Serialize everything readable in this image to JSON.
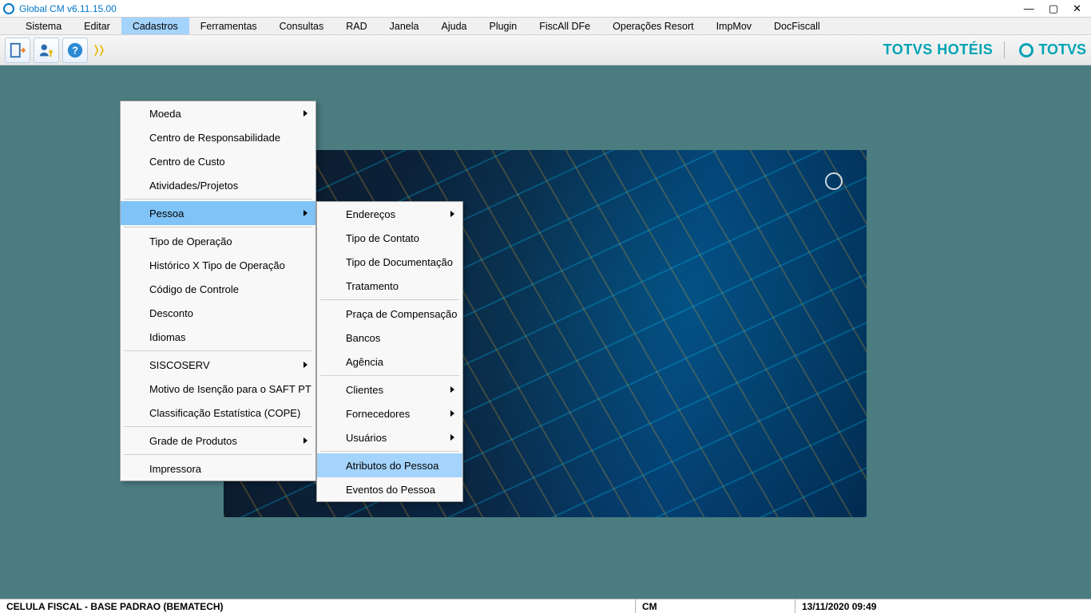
{
  "window": {
    "title": "Global CM v6.11.15.00"
  },
  "menubar": {
    "items": [
      {
        "label": "Sistema"
      },
      {
        "label": "Editar"
      },
      {
        "label": "Cadastros",
        "active": true
      },
      {
        "label": "Ferramentas"
      },
      {
        "label": "Consultas"
      },
      {
        "label": "RAD"
      },
      {
        "label": "Janela"
      },
      {
        "label": "Ajuda"
      },
      {
        "label": "Plugin"
      },
      {
        "label": "FiscAll DFe"
      },
      {
        "label": "Operações Resort"
      },
      {
        "label": "ImpMov"
      },
      {
        "label": "DocFiscall"
      }
    ]
  },
  "brand": {
    "text1": "TOTVS HOTÉIS",
    "text2": "TOTVS"
  },
  "dropdown_main": {
    "items": [
      {
        "label": "Moeda",
        "submenu": true
      },
      {
        "label": "Centro de Responsabilidade"
      },
      {
        "label": "Centro de Custo"
      },
      {
        "label": "Atividades/Projetos"
      },
      {
        "sep": true
      },
      {
        "label": "Pessoa",
        "submenu": true,
        "hover": true
      },
      {
        "sep": true
      },
      {
        "label": "Tipo de Operação"
      },
      {
        "label": "Histórico  X Tipo de Operação"
      },
      {
        "label": "Código de Controle"
      },
      {
        "label": "Desconto"
      },
      {
        "label": "Idiomas"
      },
      {
        "sep": true
      },
      {
        "label": "SISCOSERV",
        "submenu": true
      },
      {
        "label": "Motivo de Isenção para o SAFT PT"
      },
      {
        "label": "Classificação Estatística (COPE)"
      },
      {
        "sep": true
      },
      {
        "label": "Grade de Produtos",
        "submenu": true
      },
      {
        "sep": true
      },
      {
        "label": "Impressora"
      }
    ]
  },
  "dropdown_sub": {
    "items": [
      {
        "label": "Endereços",
        "submenu": true
      },
      {
        "label": "Tipo de Contato"
      },
      {
        "label": "Tipo de Documentação"
      },
      {
        "label": "Tratamento"
      },
      {
        "sep": true
      },
      {
        "label": "Praça de Compensação"
      },
      {
        "label": "Bancos"
      },
      {
        "label": "Agência"
      },
      {
        "sep": true
      },
      {
        "label": "Clientes",
        "submenu": true
      },
      {
        "label": "Fornecedores",
        "submenu": true
      },
      {
        "label": "Usuários",
        "submenu": true
      },
      {
        "sep": true
      },
      {
        "label": "Atributos do Pessoa",
        "hover": true
      },
      {
        "label": "Eventos do Pessoa"
      }
    ]
  },
  "status": {
    "left": "CELULA FISCAL - BASE PADRAO (BEMATECH)",
    "mid": "CM",
    "right": "13/11/2020 09:49"
  },
  "colors": {
    "accent": "#00a3b4",
    "menu_highlight": "#a4d3fc",
    "workspace": "#4a7c80"
  }
}
